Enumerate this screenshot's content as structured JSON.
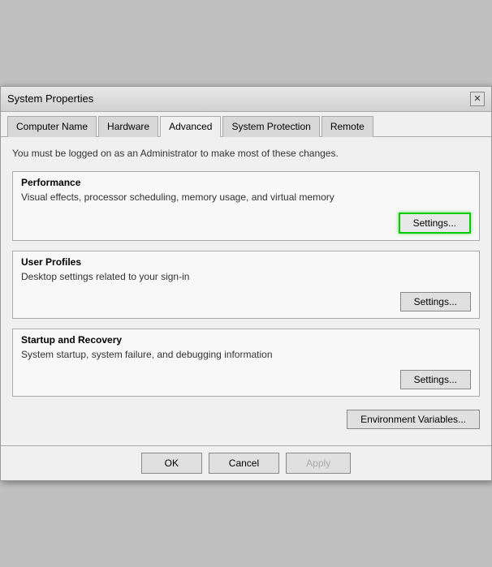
{
  "window": {
    "title": "System Properties",
    "close_icon": "✕"
  },
  "tabs": [
    {
      "label": "Computer Name",
      "active": false
    },
    {
      "label": "Hardware",
      "active": false
    },
    {
      "label": "Advanced",
      "active": true
    },
    {
      "label": "System Protection",
      "active": false
    },
    {
      "label": "Remote",
      "active": false
    }
  ],
  "admin_notice": "You must be logged on as an Administrator to make most of these changes.",
  "sections": [
    {
      "title": "Performance",
      "desc": "Visual effects, processor scheduling, memory usage, and virtual memory",
      "btn_label": "Settings...",
      "highlighted": true
    },
    {
      "title": "User Profiles",
      "desc": "Desktop settings related to your sign-in",
      "btn_label": "Settings...",
      "highlighted": false
    },
    {
      "title": "Startup and Recovery",
      "desc": "System startup, system failure, and debugging information",
      "btn_label": "Settings...",
      "highlighted": false
    }
  ],
  "env_btn_label": "Environment Variables...",
  "footer": {
    "ok_label": "OK",
    "cancel_label": "Cancel",
    "apply_label": "Apply"
  }
}
